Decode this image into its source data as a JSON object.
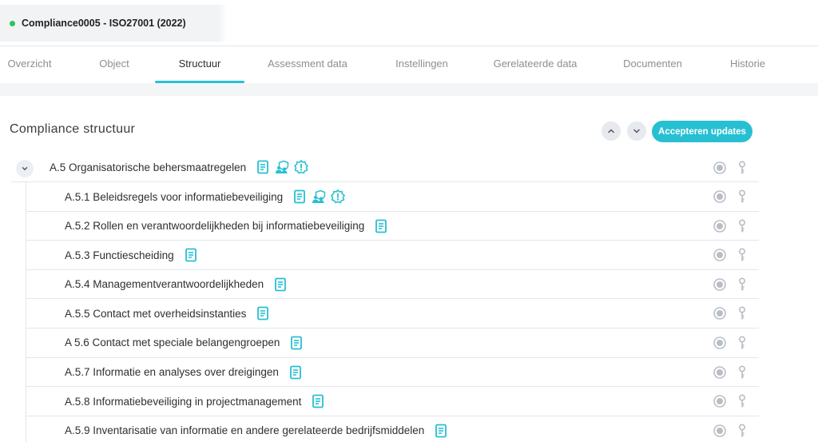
{
  "record": {
    "title": "Compliance0005 - ISO27001 (2022)",
    "status_color": "#2ec45a"
  },
  "tabs": [
    {
      "label": "Overzicht",
      "active": false
    },
    {
      "label": "Object",
      "active": false
    },
    {
      "label": "Structuur",
      "active": true
    },
    {
      "label": "Assessment data",
      "active": false
    },
    {
      "label": "Instellingen",
      "active": false
    },
    {
      "label": "Gerelateerde data",
      "active": false
    },
    {
      "label": "Documenten",
      "active": false
    },
    {
      "label": "Historie",
      "active": false
    }
  ],
  "section": {
    "title": "Compliance structuur",
    "accept_label": "Accepteren updates"
  },
  "colors": {
    "accent": "#27c0d2",
    "icon_grey": "#b9bec5"
  },
  "tree": {
    "parent": {
      "label": "A.5 Organisatorische behersmaatregelen",
      "icons": [
        "document-icon",
        "people-shield-icon",
        "warning-gear-icon"
      ]
    },
    "children": [
      {
        "label": "A.5.1 Beleidsregels voor informatiebeveiliging",
        "icons": [
          "document-icon",
          "people-shield-icon",
          "warning-gear-icon"
        ]
      },
      {
        "label": "A.5.2 Rollen en verantwoordelijkheden bij informatiebeveiliging",
        "icons": [
          "document-icon"
        ]
      },
      {
        "label": "A.5.3 Functiescheiding",
        "icons": [
          "document-icon"
        ]
      },
      {
        "label": "A.5.4 Managementverantwoordelijkheden",
        "icons": [
          "document-icon"
        ]
      },
      {
        "label": "A.5.5 Contact met overheidsinstanties",
        "icons": [
          "document-icon"
        ]
      },
      {
        "label": "A 5.6 Contact met speciale belangengroepen",
        "icons": [
          "document-icon"
        ]
      },
      {
        "label": "A.5.7 Informatie en analyses over dreigingen",
        "icons": [
          "document-icon"
        ]
      },
      {
        "label": "A.5.8 Informatiebeveiliging in projectmanagement",
        "icons": [
          "document-icon"
        ]
      },
      {
        "label": "A.5.9 Inventarisatie van informatie en andere gerelateerde bedrijfsmiddelen",
        "icons": [
          "document-icon"
        ]
      }
    ]
  }
}
